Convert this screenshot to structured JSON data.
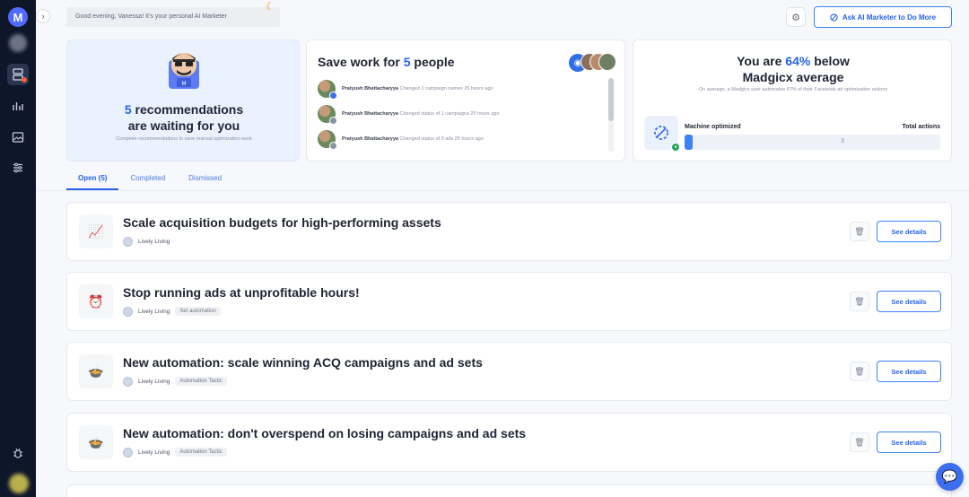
{
  "app": {
    "logo_letter": "M"
  },
  "sidebar": {
    "items": [
      {
        "name": "recommendations",
        "icon": "ai-marketer-icon",
        "active": true
      },
      {
        "name": "analytics",
        "icon": "bar-chart-icon"
      },
      {
        "name": "creatives",
        "icon": "image-icon"
      },
      {
        "name": "automation",
        "icon": "sliders-icon"
      }
    ],
    "bottom": {
      "icon": "bug-icon"
    }
  },
  "header": {
    "greeting": "Good evening, Vanessa! It's your personal AI Marketer",
    "ask_button": "Ask AI Marketer to Do More"
  },
  "recommendations_card": {
    "count": "5",
    "title_line1": "recommendations",
    "title_line2": "are waiting for you",
    "subtitle": "Complete recommendations to save manual optimization work"
  },
  "save_work_card": {
    "title_prefix": "Save work for",
    "count": "5",
    "title_suffix": "people",
    "activities": [
      {
        "name": "Pratyush Bhattacharyya",
        "action": "Changed 1 campaign names 25 hours ago"
      },
      {
        "name": "Pratyush Bhattacharyya",
        "action": "Changed status of 1 campaigns 25 hours ago"
      },
      {
        "name": "Pratyush Bhattacharyya",
        "action": "Changed status of 9 ads 25 hours ago"
      }
    ]
  },
  "benchmark_card": {
    "title_prefix": "You are",
    "percent": "64%",
    "title_suffix": "below",
    "title_line2": "Madgicx average",
    "subtitle": "On average, a Madgicx user automates 67% of their Facebook ad optimization actions",
    "machine_label": "Machine optimized",
    "total_label": "Total actions",
    "total_value": "3",
    "machine_fraction": 0.03
  },
  "tabs": [
    {
      "label": "Open (5)",
      "active": true
    },
    {
      "label": "Completed"
    },
    {
      "label": "Dismissed"
    }
  ],
  "recommendations": [
    {
      "icon": "📈",
      "title": "Scale acquisition budgets for high-performing assets",
      "account": "Lively Living",
      "tag": ""
    },
    {
      "icon": "⏰",
      "title": "Stop running ads at unprofitable hours!",
      "account": "Lively Living",
      "tag": "Set automation"
    },
    {
      "icon": "🍲",
      "title": "New automation: scale winning ACQ campaigns and ad sets",
      "account": "Lively Living",
      "tag": "Automation Tactic"
    },
    {
      "icon": "🍲",
      "title": "New automation: don't overspend on losing campaigns and ad sets",
      "account": "Lively Living",
      "tag": "Automation Tactic"
    }
  ],
  "row_button": "See details",
  "colors": {
    "accent": "#2563eb",
    "sidebar": "#0e1629",
    "success": "#22a55a"
  }
}
